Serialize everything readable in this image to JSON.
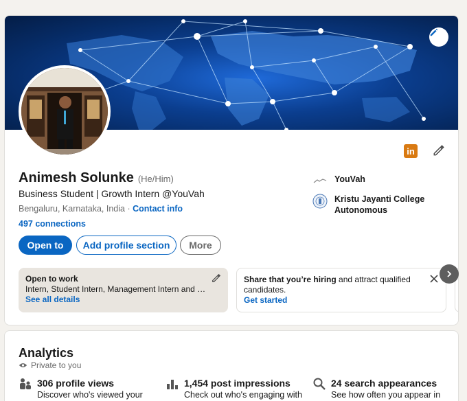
{
  "profile": {
    "name": "Animesh Solunke",
    "pronouns": "(He/Him)",
    "headline": "Business Student | Growth Intern @YouVah",
    "location": "Bengaluru, Karnataka, India",
    "separator": "·",
    "contact_info": "Contact info",
    "connections": "497 connections",
    "linkedin_badge": "in"
  },
  "orgs": [
    {
      "name": "YouVah"
    },
    {
      "name": "Kristu Jayanti College Autonomous"
    }
  ],
  "actions": {
    "open_to": "Open to",
    "add_section": "Add profile section",
    "more": "More"
  },
  "promo_open": {
    "title": "Open to work",
    "roles": "Intern, Student Intern, Management Intern and B...",
    "link": "See all details"
  },
  "promo_hire": {
    "bold_text": "Share that you’re hiring",
    "rest_text": " and attract qualified candidates.",
    "link": "Get started"
  },
  "analytics": {
    "title": "Analytics",
    "private": "Private to you",
    "stats": [
      {
        "title": "306 profile views",
        "desc": "Discover who's viewed your"
      },
      {
        "title": "1,454 post impressions",
        "desc": "Check out who's engaging with"
      },
      {
        "title": "24 search appearances",
        "desc": "See how often you appear in"
      }
    ]
  },
  "colors": {
    "brand": "#0a66c2",
    "linkedin_badge": "#d97a12",
    "open_to_work_bg": "#e9e5df"
  },
  "icons": [
    "pencil-icon",
    "linkedin-icon",
    "close-icon",
    "chevron-right-icon",
    "eye-icon",
    "people-icon",
    "bar-chart-icon",
    "search-icon"
  ]
}
